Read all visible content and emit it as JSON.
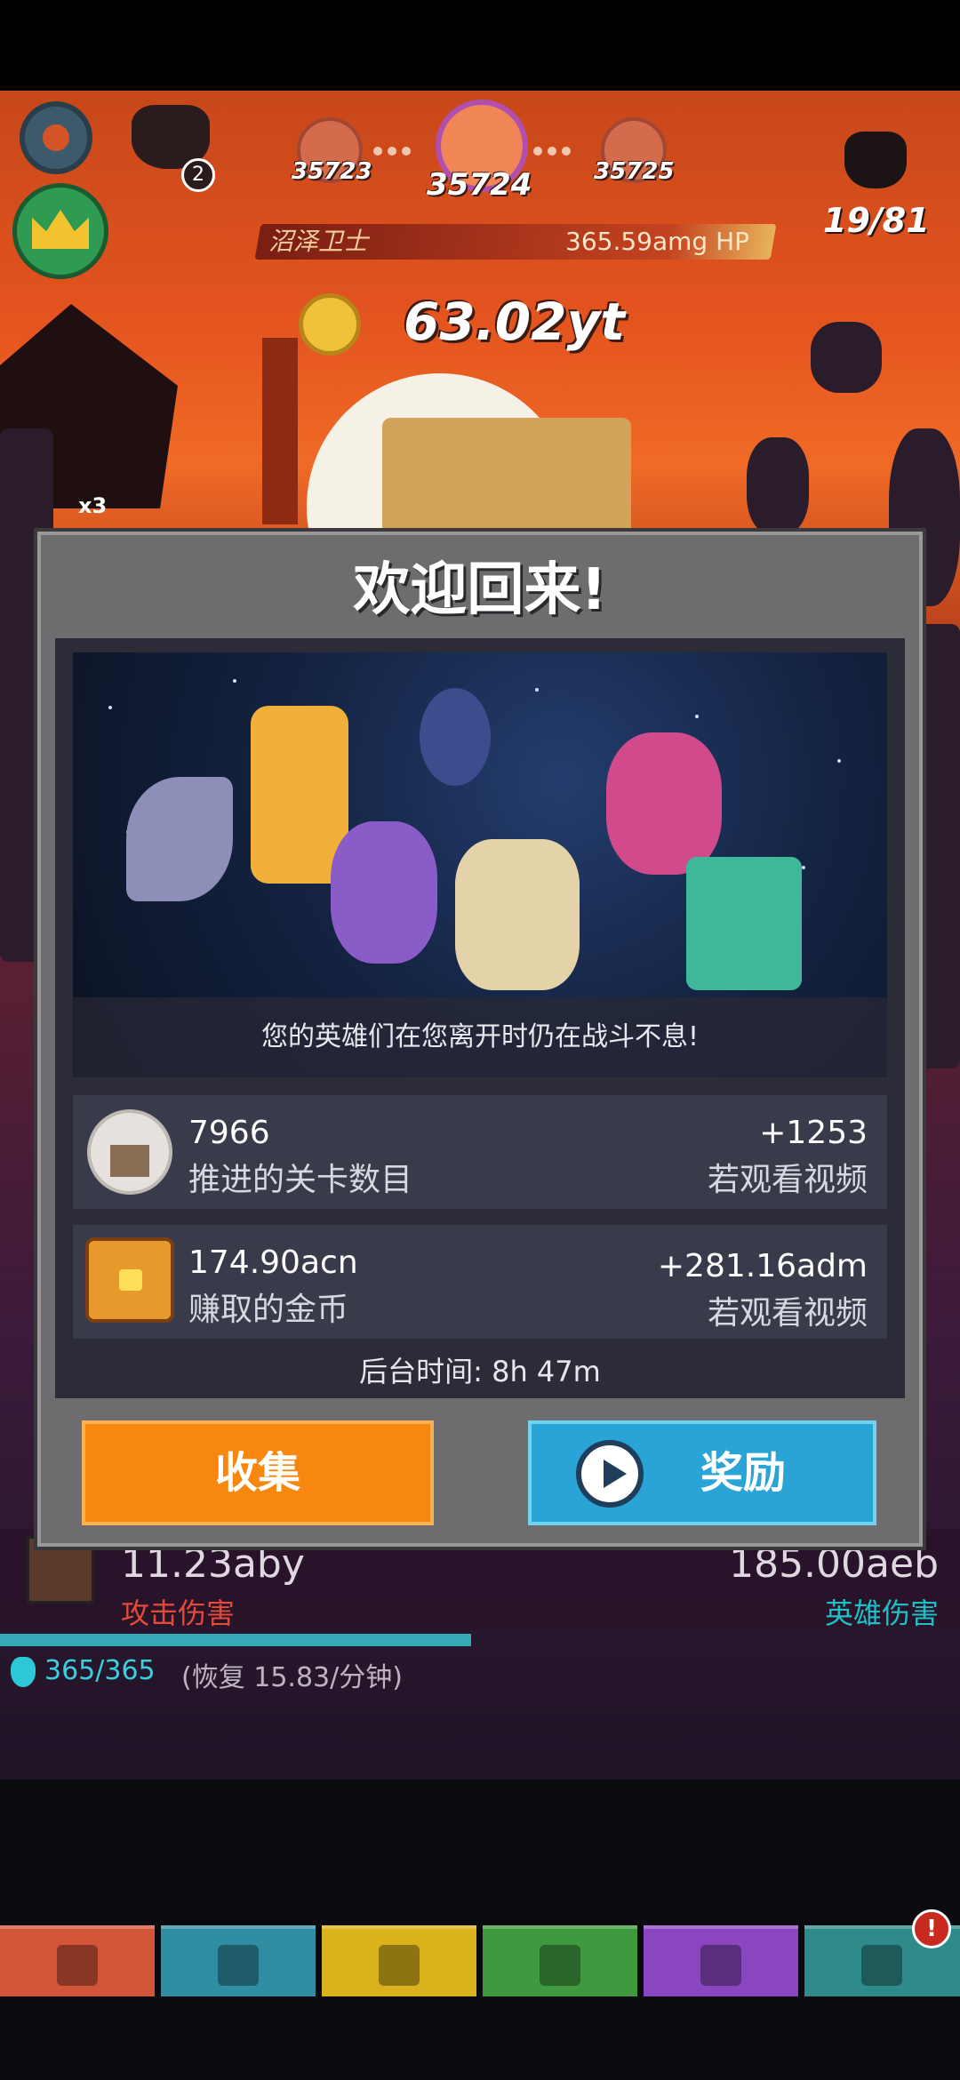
{
  "hud": {
    "stage_prev": "35723",
    "stage_current": "35724",
    "stage_next": "35725",
    "boss_name": "沼泽卫士",
    "boss_hp": "365.59amg HP",
    "gold": "63.02yt",
    "demon_badge": "2",
    "kills": "19/81",
    "multiplier": "x3"
  },
  "modal": {
    "title": "欢迎回来!",
    "caption": "您的英雄们在您离开时仍在战斗不息!",
    "stages": {
      "value": "7966",
      "label": "推进的关卡数目",
      "bonus": "+1253",
      "bonus_label": "若观看视频"
    },
    "coins": {
      "value": "174.90acn",
      "label": "赚取的金币",
      "bonus": "+281.16adm",
      "bonus_label": "若观看视频"
    },
    "background_time": "后台时间:  8h 47m",
    "collect_label": "收集",
    "reward_label": "奖励"
  },
  "hero_panel": {
    "attack_value": "11.23aby",
    "attack_label": "攻击伤害",
    "hero_value": "185.00aeb",
    "hero_label": "英雄伤害",
    "mana": "365/365",
    "regen": "(恢复 15.83/分钟)"
  },
  "tabs": [
    {
      "icon": "sword-icon",
      "color": "#d2553a"
    },
    {
      "icon": "helmet-icon",
      "color": "#2f8ea2"
    },
    {
      "icon": "armor-icon",
      "color": "#d9b21c"
    },
    {
      "icon": "pet-icon",
      "color": "#3f9a3f"
    },
    {
      "icon": "heart-icon",
      "color": "#8a45c0"
    },
    {
      "icon": "shop-icon",
      "color": "#2f8a8a"
    }
  ],
  "tab_alert": "!"
}
